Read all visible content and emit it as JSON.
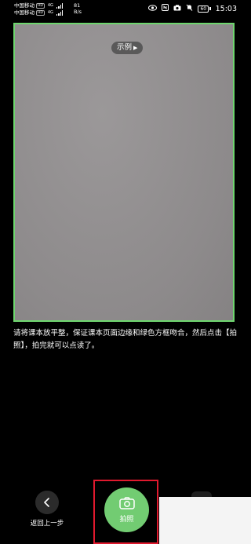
{
  "status_bar": {
    "carrier1": "中国移动",
    "carrier2": "中国移动",
    "hd_badge": "HD",
    "gen1": "4G",
    "gen2": "4G",
    "net_speed_value": "81",
    "net_speed_unit": "B/s",
    "battery": "60",
    "time": "15:03"
  },
  "preview": {
    "example_label": "示例"
  },
  "instruction_text": "请将课本放平整，保证课本页面边缘和绿色方框吻合，然后点击【拍照】，拍完就可以点读了。",
  "bottom": {
    "back_label": "返回上一步",
    "shutter_label": "拍照"
  },
  "colors": {
    "frame_green": "#6ed66e",
    "shutter_green": "#72cc72",
    "highlight_red": "#e0192e"
  }
}
